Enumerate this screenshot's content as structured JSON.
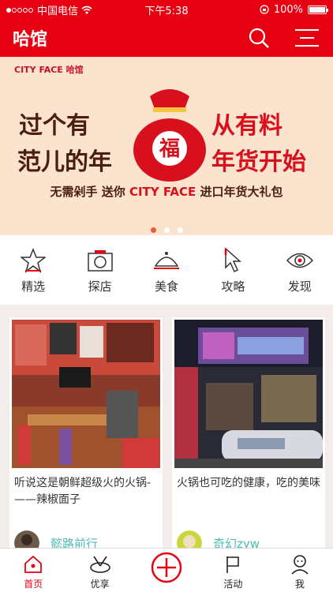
{
  "status": {
    "carrier": "中国电信",
    "time": "下午5:38",
    "battery": "100%"
  },
  "header": {
    "logo": "哈馆",
    "search_icon": "search-icon",
    "menu_icon": "menu-icon"
  },
  "banner": {
    "brand": "CITY FACE  哈馆",
    "left_line1": "过个有",
    "left_line2": "范儿的年",
    "right_line1": "从有料",
    "right_line2": "年货开始",
    "sub_prefix": "无需剁手 送你",
    "sub_brand": "CITY FACE",
    "sub_suffix": "进口年货大礼包",
    "bag_char": "福",
    "pages": 3,
    "active_page": 0
  },
  "categories": [
    {
      "label": "精选",
      "icon": "star-icon"
    },
    {
      "label": "探店",
      "icon": "camera-icon"
    },
    {
      "label": "美食",
      "icon": "food-cover-icon"
    },
    {
      "label": "攻略",
      "icon": "cursor-icon"
    },
    {
      "label": "发现",
      "icon": "eye-icon"
    }
  ],
  "feed": [
    {
      "title": "听说这是朝鲜超级火的火锅-——辣椒面子",
      "author": "懿路前行"
    },
    {
      "title": "火锅也可吃的健康，吃的美味",
      "author": "奇幻zyw"
    }
  ],
  "tabs": [
    {
      "label": "首页",
      "icon": "home-icon",
      "active": true
    },
    {
      "label": "优享",
      "icon": "cutlery-icon",
      "active": false
    },
    {
      "label": "",
      "icon": "add-icon",
      "active": false
    },
    {
      "label": "活动",
      "icon": "flag-icon",
      "active": false
    },
    {
      "label": "我",
      "icon": "user-icon",
      "active": false
    }
  ],
  "colors": {
    "brand_red": "#e60012",
    "teal_author": "#4cbcb0"
  }
}
